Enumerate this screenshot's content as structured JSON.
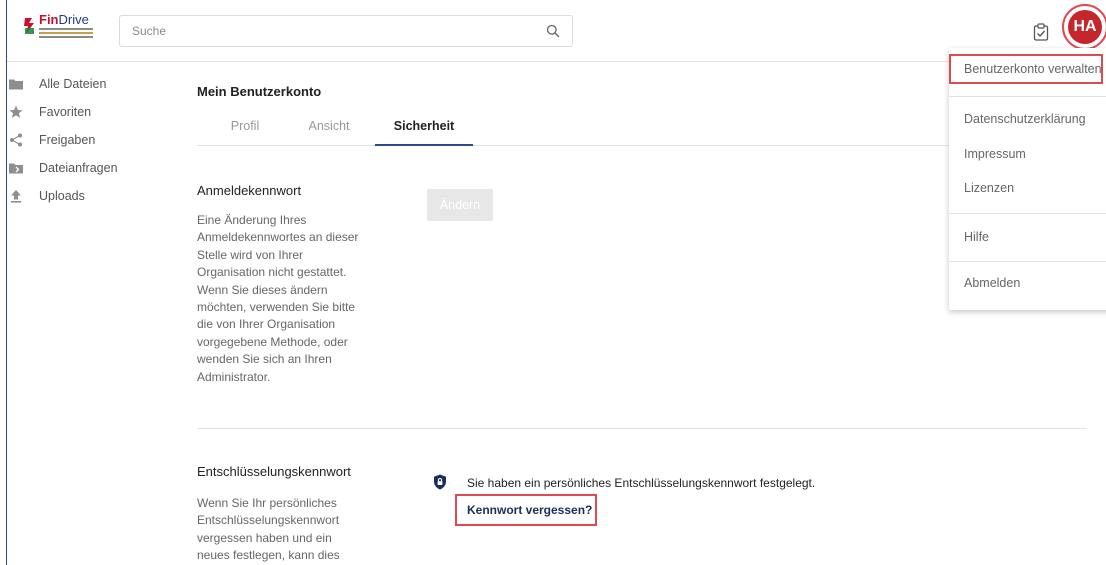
{
  "app": {
    "brand_fin": "Fin",
    "brand_drive": "Drive"
  },
  "search": {
    "placeholder": "Suche"
  },
  "avatar": {
    "initials": "HA"
  },
  "sidebar": {
    "items": [
      {
        "label": "Alle Dateien",
        "icon": "folder-icon"
      },
      {
        "label": "Favoriten",
        "icon": "star-icon"
      },
      {
        "label": "Freigaben",
        "icon": "share-icon"
      },
      {
        "label": "Dateianfragen",
        "icon": "folder-request-icon"
      },
      {
        "label": "Uploads",
        "icon": "upload-icon"
      }
    ]
  },
  "main": {
    "title": "Mein Benutzerkonto",
    "tabs": [
      {
        "label": "Profil"
      },
      {
        "label": "Ansicht"
      },
      {
        "label": "Sicherheit"
      }
    ],
    "active_tab": "Sicherheit",
    "password": {
      "title": "Anmeldekennwort",
      "desc_lines": [
        "Eine Änderung Ihres",
        "Anmeldekennwortes an dieser",
        "Stelle wird von Ihrer",
        "Organisation nicht gestattet.",
        "Wenn Sie dieses ändern",
        "möchten, verwenden Sie bitte",
        "die von Ihrer Organisation",
        "vorgegebene Methode, oder",
        "wenden Sie sich an Ihren",
        "Administrator."
      ],
      "change_label": "Ändern"
    },
    "encryption": {
      "title": "Entschlüsselungskennwort",
      "desc_lines": [
        "Wenn Sie Ihr persönliches",
        "Entschlüsselungskennwort",
        "vergessen haben und ein",
        "neues festlegen, kann dies"
      ],
      "status": "Sie haben ein persönliches Entschlüsselungskennwort festgelegt.",
      "forgot_label": "Kennwort vergessen?"
    }
  },
  "menu": {
    "items": [
      {
        "label": "Benutzerkonto verwalten"
      },
      {
        "label": "Datenschutzerklärung"
      },
      {
        "label": "Impressum"
      },
      {
        "label": "Lizenzen"
      },
      {
        "label": "Hilfe"
      },
      {
        "label": "Abmelden"
      }
    ]
  },
  "colors": {
    "accent": "#2b4a8c",
    "avatar": "#c5262c",
    "highlight": "#e2484f"
  }
}
